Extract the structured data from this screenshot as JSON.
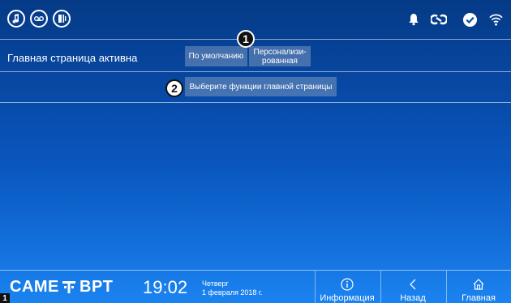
{
  "topbar": {
    "left_icons": [
      "tv-remote-icon",
      "voicemail-icon",
      "door-intercom-icon"
    ],
    "right_icons": [
      "bell-icon",
      "link-icon",
      "check-circle-icon",
      "wifi-icon"
    ]
  },
  "home_setting": {
    "label": "Главная страница активна",
    "option_default": "По умолчанию",
    "option_custom_line1": "Персонализи-",
    "option_custom_line2": "рованная",
    "marker1": "1"
  },
  "functions": {
    "button_label": "Выберите функции главной страницы",
    "marker2": "2"
  },
  "bottombar": {
    "brand_left": "CAME",
    "brand_right": "BPT",
    "time": "19:02",
    "weekday": "Четверг",
    "date": "1 февраля 2018 г.",
    "nav": [
      {
        "label": "Информация",
        "icon": "info-icon"
      },
      {
        "label": "Назад",
        "icon": "back-chevron-icon"
      },
      {
        "label": "Главная",
        "icon": "home-icon"
      }
    ],
    "corner_number": "1"
  },
  "colors": {
    "bg_top": "#053a86",
    "bg_bottom": "#1a83f0",
    "button_bg": "#7896be"
  }
}
